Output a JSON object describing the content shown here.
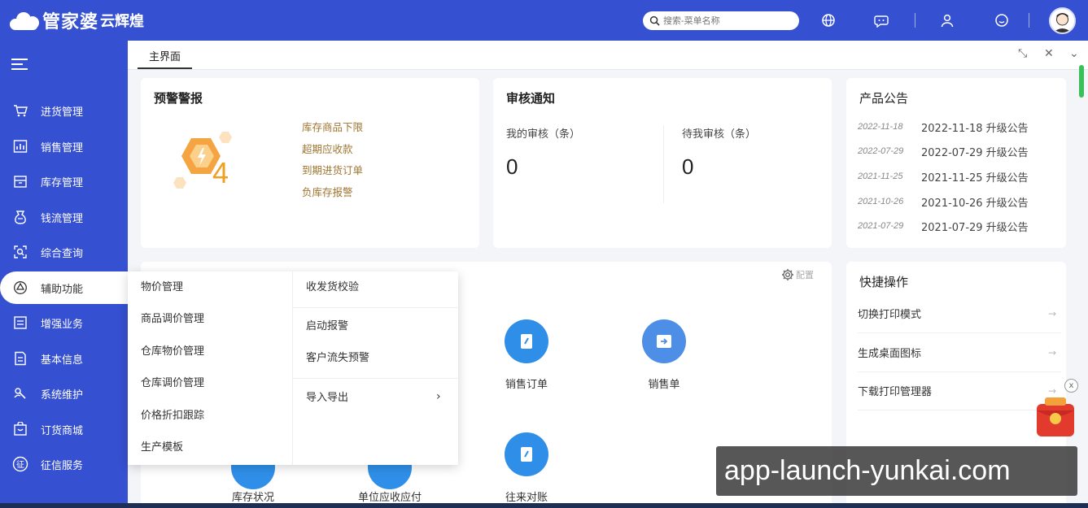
{
  "header": {
    "brand": "管家婆",
    "subbrand": "云辉煌",
    "search_placeholder": "搜索-菜单名称"
  },
  "sidebar": {
    "items": [
      {
        "label": "进货管理",
        "icon": "cart-icon"
      },
      {
        "label": "销售管理",
        "icon": "chart-icon"
      },
      {
        "label": "库存管理",
        "icon": "warehouse-icon"
      },
      {
        "label": "钱流管理",
        "icon": "money-icon"
      },
      {
        "label": "综合查询",
        "icon": "query-icon"
      },
      {
        "label": "辅助功能",
        "icon": "assist-icon"
      },
      {
        "label": "增强业务",
        "icon": "enhance-icon"
      },
      {
        "label": "基本信息",
        "icon": "info-icon"
      },
      {
        "label": "系统维护",
        "icon": "maintain-icon"
      },
      {
        "label": "订货商城",
        "icon": "shop-icon"
      },
      {
        "label": "征信服务",
        "icon": "credit-icon"
      }
    ]
  },
  "tabs": {
    "main": "主界面"
  },
  "alerts": {
    "title": "预警警报",
    "count": "4",
    "items": [
      "库存商品下限",
      "超期应收款",
      "到期进货订单",
      "负库存报警"
    ]
  },
  "audit": {
    "title": "审核通知",
    "mine_label": "我的审核（条）",
    "mine_value": "0",
    "pending_label": "待我审核（条）",
    "pending_value": "0"
  },
  "announcements": {
    "title": "产品公告",
    "items": [
      {
        "date": "2022-11-18",
        "text": "2022-11-18 升级公告"
      },
      {
        "date": "2022-07-29",
        "text": "2022-07-29 升级公告"
      },
      {
        "date": "2021-11-25",
        "text": "2021-11-25 升级公告"
      },
      {
        "date": "2021-10-26",
        "text": "2021-10-26 升级公告"
      },
      {
        "date": "2021-07-29",
        "text": "2021-07-29 升级公告"
      }
    ]
  },
  "functions": {
    "config_label": "配置",
    "items": [
      "销售订单",
      "销售单",
      "库存状况",
      "单位应收应付",
      "往来对账"
    ]
  },
  "quick": {
    "title": "快捷操作",
    "items": [
      "切换打印模式",
      "生成桌面图标",
      "下载打印管理器"
    ]
  },
  "flyout": {
    "col1": [
      "物价管理",
      "商品调价管理",
      "仓库物价管理",
      "仓库调价管理",
      "价格折扣跟踪",
      "生产模板"
    ],
    "col2": [
      "收发货校验",
      "启动报警",
      "客户流失预警",
      "导入导出"
    ]
  },
  "watermark": "app-launch-yunkai.com",
  "colors": {
    "primary": "#3550d0",
    "alert_text": "#a07530",
    "func_blue": "#2f8fe8"
  }
}
